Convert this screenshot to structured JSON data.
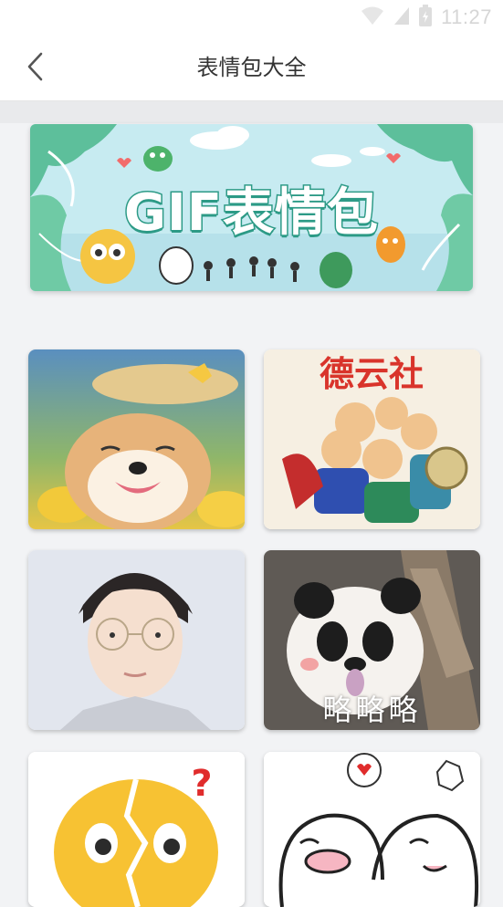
{
  "status_bar": {
    "time": "11:27"
  },
  "header": {
    "title": "表情包大全",
    "back_icon": "chevron-left-icon"
  },
  "banner": {
    "title": "GIF表情包"
  },
  "grid": {
    "items": [
      {
        "subject": "shiba-dog-straw-hat"
      },
      {
        "subject": "deyunshe-cartoon-group",
        "overlay_text": "德云社"
      },
      {
        "subject": "boy-with-glasses"
      },
      {
        "subject": "panda-tongue-out",
        "caption": "略略略"
      },
      {
        "subject": "cracked-emoji-question",
        "overlay_text": "?"
      },
      {
        "subject": "cartoon-faces-heart"
      }
    ]
  },
  "colors": {
    "header_bg": "#ffffff",
    "page_bg": "#f2f3f5",
    "title_text": "#333333",
    "banner_bg": "#bfe6ee",
    "banner_title_stroke": "#2c9a86"
  }
}
